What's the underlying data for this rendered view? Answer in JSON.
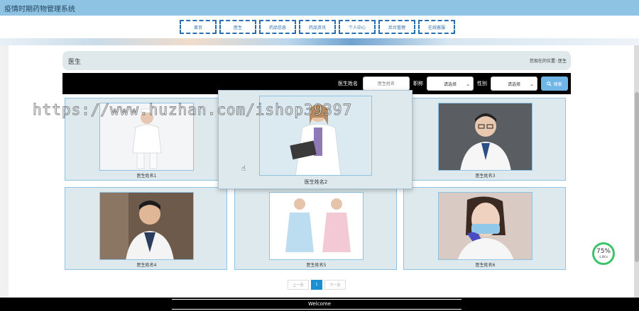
{
  "header": {
    "app_title": "疫情时期药物管理系统"
  },
  "nav": {
    "items": [
      {
        "label": "首页"
      },
      {
        "label": "医生"
      },
      {
        "label": "药品信息"
      },
      {
        "label": "药品资讯"
      },
      {
        "label": "个人中心"
      },
      {
        "label": "后台管理"
      },
      {
        "label": "在线客服"
      }
    ]
  },
  "section": {
    "title": "医生",
    "breadcrumb_prefix": "您现在的位置:",
    "breadcrumb_current": "医生"
  },
  "search": {
    "name_label": "医生姓名",
    "name_placeholder": "医生姓名",
    "title_label": "职称",
    "title_selected": "请选择",
    "gender_label": "性别",
    "gender_selected": "请选择",
    "button_label": "搜索"
  },
  "doctors": [
    {
      "name": "医生姓名1"
    },
    {
      "name": "医生姓名2"
    },
    {
      "name": "医生姓名3"
    },
    {
      "name": "医生姓名4"
    },
    {
      "name": "医生姓名5"
    },
    {
      "name": "医生姓名6"
    }
  ],
  "pagination": {
    "prev_label": "上一页",
    "current_page": "1",
    "next_label": "下一页"
  },
  "footer": {
    "text": "Welcome"
  },
  "watermark": "https://www.huzhan.com/ishop39397",
  "badge": {
    "percent": "75%",
    "rate": "4.8K/s"
  },
  "colors": {
    "header_bg": "#8ec3e4",
    "nav_border": "#2a6fb0",
    "search_bar_bg": "#000000",
    "search_button": "#6fb6e6",
    "card_bg": "#dde9ec",
    "page_active": "#1a8fd1",
    "badge_ring": "#3cc36a"
  }
}
